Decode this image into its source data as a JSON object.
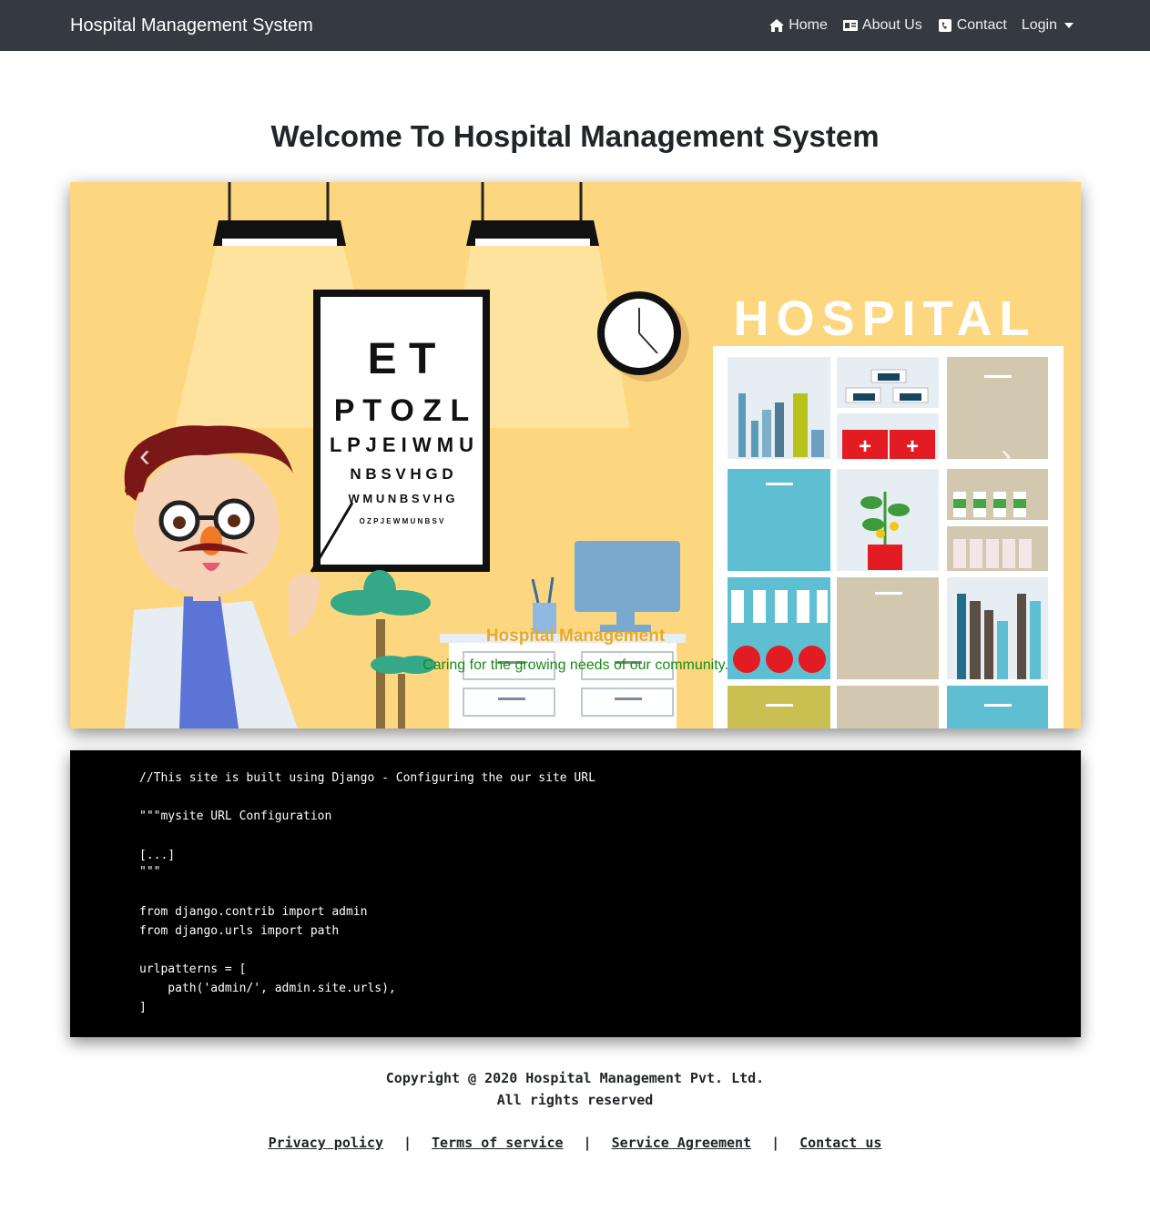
{
  "navbar": {
    "brand": "Hospital Management System",
    "items": [
      {
        "label": "Home",
        "icon": "home-icon"
      },
      {
        "label": "About Us",
        "icon": "id-card-icon"
      },
      {
        "label": "Contact",
        "icon": "phone-icon"
      },
      {
        "label": "Login",
        "icon": "caret-down-icon"
      }
    ]
  },
  "main": {
    "title": "Welcome To Hospital Management System"
  },
  "carousel": {
    "sign": "HOSPITAL",
    "eye_chart": [
      "E T",
      "P T O Z L",
      "L P J E I W M U",
      "N B S V H G D",
      "W M U N B S V H G",
      "O Z P J E W M U N B S V"
    ],
    "caption_title": "Hospital Management",
    "caption_text": "Caring for the growing needs of our community.",
    "prev_glyph": "‹",
    "next_glyph": "›"
  },
  "code": {
    "lines": [
      "//This site is built using Django - Configuring the our site URL",
      "",
      "\"\"\"mysite URL Configuration",
      "",
      "[...]",
      "\"\"\"",
      "",
      "from django.contrib import admin",
      "from django.urls import path",
      "",
      "urlpatterns = [",
      "    path('admin/', admin.site.urls),",
      "]"
    ]
  },
  "footer": {
    "copyright_line1": "Copyright @ 2020 Hospital Management Pvt. Ltd.",
    "copyright_line2": "All rights reserved",
    "links": [
      "Privacy policy",
      "Terms of service",
      "Service Agreement",
      "Contact us"
    ],
    "separator": "|"
  },
  "colors": {
    "navbar_bg": "#343a40",
    "carousel_bg": "#fdd77f",
    "caption_title": "#f0a81e",
    "caption_text": "#1a8a1a",
    "code_bg": "#000000"
  }
}
